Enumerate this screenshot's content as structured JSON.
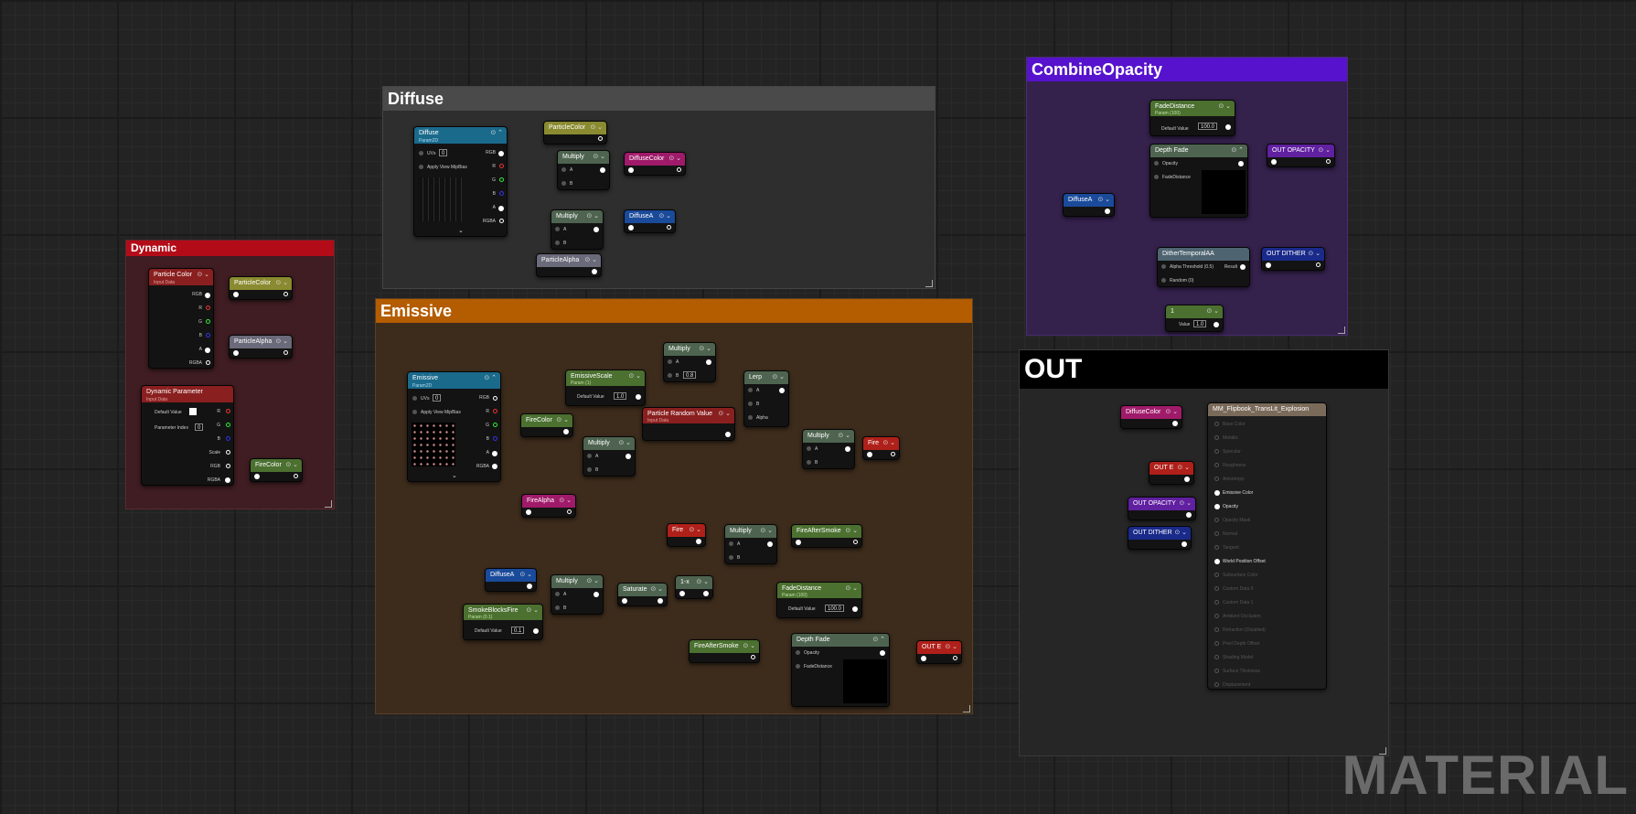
{
  "comments": {
    "dynamic": "Dynamic",
    "diffuse": "Diffuse",
    "emissive": "Emissive",
    "combine": "CombineOpacity",
    "out": "OUT"
  },
  "watermark": "MATERIAL",
  "colors": {
    "dynamic_title": "#b30c18",
    "dynamic_body": "#3f1d22",
    "diffuse_title": "#4a4a4a",
    "diffuse_body": "#2e2e2e",
    "emissive_title": "#b45c00",
    "emissive_body": "#3d2c1c",
    "combine_title": "#5612cc",
    "combine_body": "#34214c",
    "out_title": "#000000",
    "out_body": "#262626",
    "texture_header": "#1a6a8c",
    "param_header": "#4b7030",
    "math_header": "#4e6450",
    "particle_header": "#8a1f1f"
  },
  "nodes": {
    "particle_color": {
      "title": "Particle Color",
      "sub": "Input Data",
      "pins": [
        "RGB",
        "R",
        "G",
        "B",
        "A",
        "RGBA"
      ]
    },
    "dyn_particlecolor": "ParticleColor",
    "dyn_particlealpha": "ParticleAlpha",
    "dynamic_param": {
      "title": "Dynamic Parameter",
      "sub": "Input Data",
      "default_label": "Default Value",
      "index_label": "Parameter Index",
      "index_value": "0",
      "outs": [
        "R",
        "G",
        "B",
        "Scale",
        "RGB",
        "RGBA"
      ]
    },
    "dyn_firecolor": "FireColor",
    "diffuse_tex": {
      "title": "Diffuse",
      "sub": "Param2D",
      "uvs": "UVs",
      "uvs_val": "0",
      "mip": "Apply View MipBias",
      "outs": [
        "RGB",
        "R",
        "G",
        "B",
        "A",
        "RGBA"
      ]
    },
    "dif_particlecolor": "ParticleColor",
    "dif_multiply1": "Multiply",
    "dif_diffusecolor": "DiffuseColor",
    "dif_multiply2": "Multiply",
    "dif_diffusea": "DiffuseA",
    "dif_particlealpha": "ParticleAlpha",
    "emissive_tex": {
      "title": "Emissive",
      "sub": "Param2D",
      "uvs": "UVs",
      "uvs_val": "0",
      "mip": "Apply View MipBias",
      "outs": [
        "RGB",
        "R",
        "G",
        "B",
        "A",
        "RGBA"
      ]
    },
    "em_scale": {
      "title": "EmissiveScale",
      "sub": "Param (1)",
      "default_label": "Default Value",
      "default_val": "1.0"
    },
    "em_multiply_top": {
      "title": "Multiply",
      "b_val": "0.8"
    },
    "em_lerp": {
      "title": "Lerp",
      "pins": [
        "A",
        "B",
        "Alpha"
      ]
    },
    "em_firecolor": "FireColor",
    "em_particle_random": {
      "title": "Particle Random Value",
      "sub": "Input Data"
    },
    "em_multiply_mid": "Multiply",
    "em_multiply_right": "Multiply",
    "em_fire_out": "Fire",
    "em_firealpha": "FireAlpha",
    "em_fire2": "Fire",
    "em_multiply_smoke": "Multiply",
    "em_fireaftersmoke1": "FireAfterSmoke",
    "em_diffusea": "DiffuseA",
    "em_multiply_low": "Multiply",
    "em_saturate": "Saturate",
    "em_onex": "1-x",
    "em_smokeblocks": {
      "title": "SmokeBlocksFire",
      "sub": "Param (0.1)",
      "default_label": "Default Value",
      "default_val": "0.1"
    },
    "em_fadedistance": {
      "title": "FadeDistance",
      "sub": "Param (100)",
      "default_label": "Default Value",
      "default_val": "100.0"
    },
    "em_fireaftersmoke2": "FireAfterSmoke",
    "em_depthfade": {
      "title": "Depth Fade",
      "pins": [
        "Opacity",
        "FadeDistance"
      ]
    },
    "em_oute": "OUT E",
    "co_fadedistance": {
      "title": "FadeDistance",
      "sub": "Param (100)",
      "default_label": "Default Value",
      "default_val": "100.0"
    },
    "co_depthfade": {
      "title": "Depth Fade",
      "pins": [
        "Opacity",
        "FadeDistance"
      ]
    },
    "co_outopacity": "OUT OPACITY",
    "co_diffusea": "DiffuseA",
    "co_dither": {
      "title": "DitherTemporalAA",
      "pins": [
        "Alpha Threshold (0.5)",
        "Random (0)"
      ],
      "result": "Result"
    },
    "co_outdither": "OUT DITHER",
    "co_const": {
      "title": "1",
      "value_label": "Value",
      "value": "1.0"
    },
    "out_diffusecolor": "DiffuseColor",
    "out_oute": "OUT E",
    "out_outopacity": "OUT OPACITY",
    "out_outdither": "OUT DITHER",
    "material": {
      "title": "MM_Flipbook_TransLit_Explosion",
      "inputs": [
        "Base Color",
        "Metallic",
        "Specular",
        "Roughness",
        "Anisotropy",
        "Emissive Color",
        "Opacity",
        "Opacity Mask",
        "Normal",
        "Tangent",
        "World Position Offset",
        "Subsurface Color",
        "Custom Data 0",
        "Custom Data 1",
        "Ambient Occlusion",
        "Refraction (Disabled)",
        "Pixel Depth Offset",
        "Shading Model",
        "Surface Thickness",
        "Displacement"
      ]
    }
  }
}
